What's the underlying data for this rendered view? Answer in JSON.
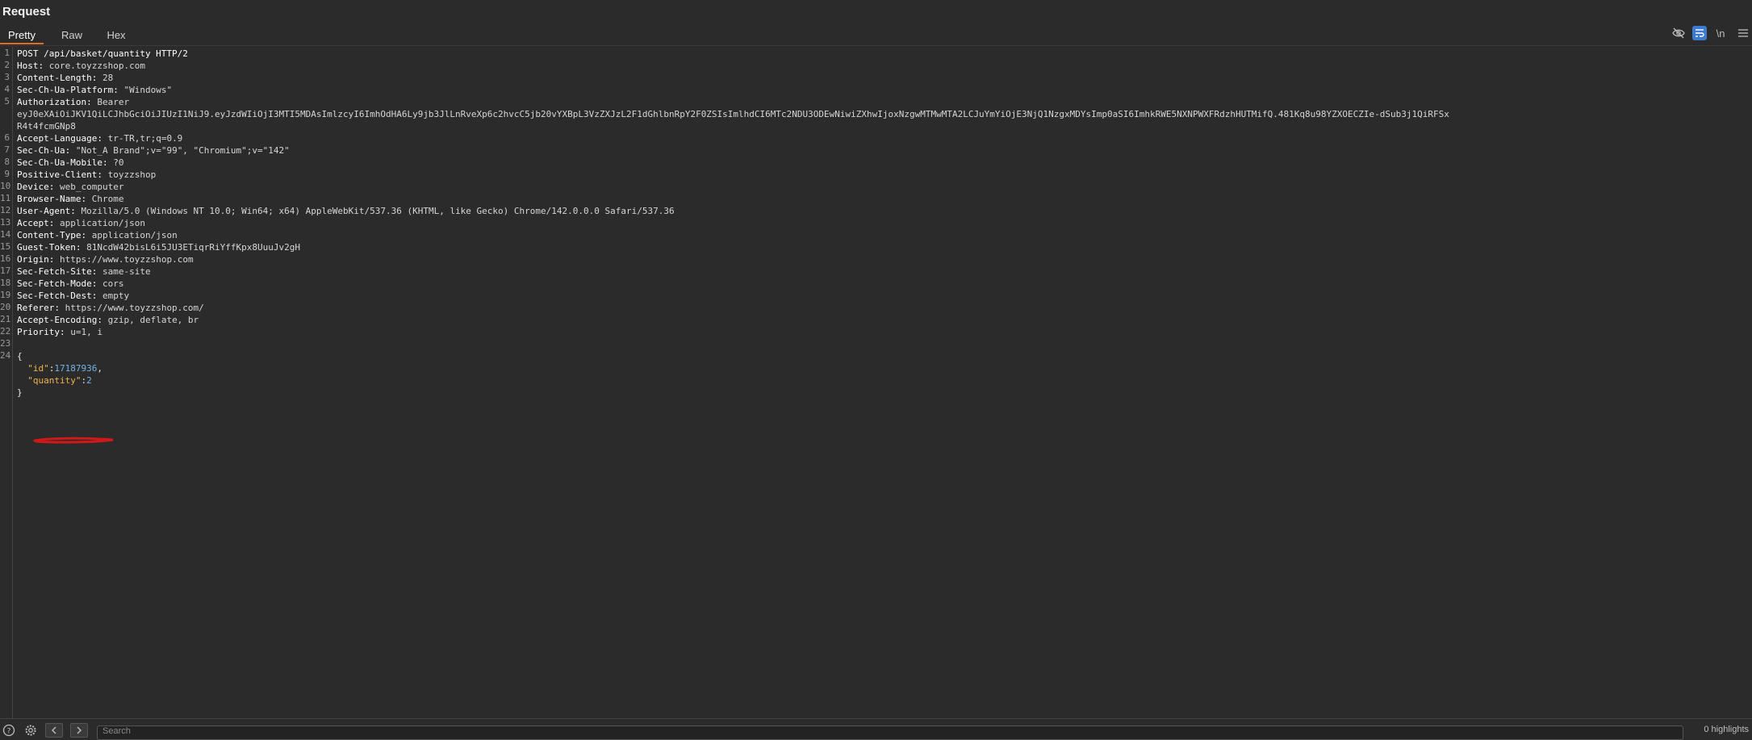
{
  "panel": {
    "title": "Request"
  },
  "tabs": [
    {
      "label": "Pretty"
    },
    {
      "label": "Raw"
    },
    {
      "label": "Hex"
    }
  ],
  "toolbar": {
    "hide_icon": "eye-off-icon",
    "wrap_icon": "wrap-lines-icon",
    "newline_label": "\\n",
    "menu_icon": "hamburger-menu-icon"
  },
  "request_line": "POST /api/basket/quantity HTTP/2",
  "headers": [
    {
      "n": "2",
      "name": "Host",
      "value": "core.toyzzshop.com"
    },
    {
      "n": "3",
      "name": "Content-Length",
      "value": "28"
    },
    {
      "n": "4",
      "name": "Sec-Ch-Ua-Platform",
      "value": "\"Windows\""
    },
    {
      "n": "5",
      "name": "Authorization",
      "value": "Bearer"
    },
    {
      "n": "6",
      "name": "Accept-Language",
      "value": "tr-TR,tr;q=0.9"
    },
    {
      "n": "7",
      "name": "Sec-Ch-Ua",
      "value": "\"Not_A Brand\";v=\"99\", \"Chromium\";v=\"142\""
    },
    {
      "n": "8",
      "name": "Sec-Ch-Ua-Mobile",
      "value": "?0"
    },
    {
      "n": "9",
      "name": "Positive-Client",
      "value": "toyzzshop"
    },
    {
      "n": "10",
      "name": "Device",
      "value": "web_computer"
    },
    {
      "n": "11",
      "name": "Browser-Name",
      "value": "Chrome"
    },
    {
      "n": "12",
      "name": "User-Agent",
      "value": "Mozilla/5.0 (Windows NT 10.0; Win64; x64) AppleWebKit/537.36 (KHTML, like Gecko) Chrome/142.0.0.0 Safari/537.36"
    },
    {
      "n": "13",
      "name": "Accept",
      "value": "application/json"
    },
    {
      "n": "14",
      "name": "Content-Type",
      "value": "application/json"
    },
    {
      "n": "15",
      "name": "Guest-Token",
      "value": "81NcdW42bisL6i5JU3ETiqrRiYffKpx8UuuJv2gH"
    },
    {
      "n": "16",
      "name": "Origin",
      "value": "https://www.toyzzshop.com"
    },
    {
      "n": "17",
      "name": "Sec-Fetch-Site",
      "value": "same-site"
    },
    {
      "n": "18",
      "name": "Sec-Fetch-Mode",
      "value": "cors"
    },
    {
      "n": "19",
      "name": "Sec-Fetch-Dest",
      "value": "empty"
    },
    {
      "n": "20",
      "name": "Referer",
      "value": "https://www.toyzzshop.com/"
    },
    {
      "n": "21",
      "name": "Accept-Encoding",
      "value": "gzip, deflate, br"
    },
    {
      "n": "22",
      "name": "Priority",
      "value": "u=1, i"
    }
  ],
  "token_lines": [
    "eyJ0eXAiOiJKV1QiLCJhbGciOiJIUzI1NiJ9.eyJzdWIiOjI3MTI5MDAsImlzcyI6ImhOdHA6Ly9jb3JlLnRveXp6c2hvcC5jb20vYXBpL3VzZXJzL2F1dGhlbnRpY2F0ZSIsImlhdCI6MTc2NDU3ODEwNiwiZXhwIjoxNzgwMTMwMTA2LCJuYmYiOjE3NjQ1NzgxMDYsImp0aSI6ImhkRWE5NXNPWXFRdzhHUTMifQ.481Kq8u98YZXOECZIe-dSub3j1QiRFSx",
    "R4t4fcmGNp8"
  ],
  "body": {
    "open": "{",
    "id_key": "\"id\"",
    "id_value": "17187936",
    "quantity_key": "\"quantity\"",
    "quantity_value": "2",
    "close": "}"
  },
  "line_numbers": [
    "1",
    "2",
    "3",
    "4",
    "5",
    "6",
    "7",
    "8",
    "9",
    "10",
    "11",
    "12",
    "13",
    "14",
    "15",
    "16",
    "17",
    "18",
    "19",
    "20",
    "21",
    "22",
    "23",
    "24"
  ],
  "bottom": {
    "search_placeholder": "Search",
    "highlights": "0 highlights"
  }
}
